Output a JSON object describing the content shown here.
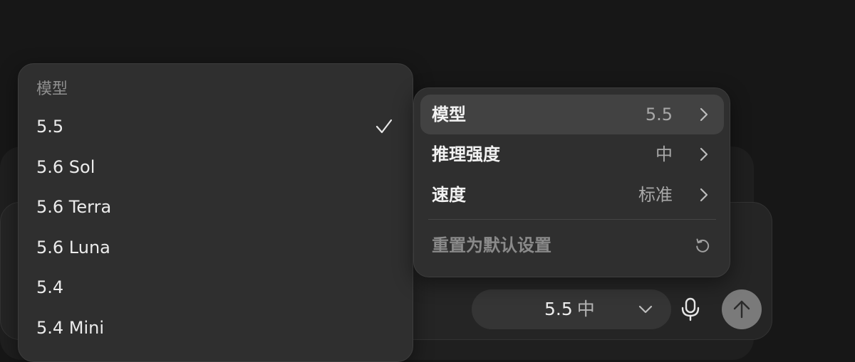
{
  "model_menu": {
    "header": "模型",
    "items": [
      {
        "label": "5.5",
        "selected": true
      },
      {
        "label": "5.6 Sol",
        "selected": false
      },
      {
        "label": "5.6 Terra",
        "selected": false
      },
      {
        "label": "5.6 Luna",
        "selected": false
      },
      {
        "label": "5.4",
        "selected": false
      },
      {
        "label": "5.4 Mini",
        "selected": false
      }
    ],
    "check_icon": "checkmark-icon"
  },
  "settings_panel": {
    "rows": [
      {
        "label": "模型",
        "value": "5.5",
        "icon": "chevron-right-icon",
        "active": true
      },
      {
        "label": "推理强度",
        "value": "中",
        "icon": "chevron-right-icon",
        "active": false
      },
      {
        "label": "速度",
        "value": "标准",
        "icon": "chevron-right-icon",
        "active": false
      }
    ],
    "reset": {
      "label": "重置为默认设置",
      "icon": "reset-icon"
    }
  },
  "composer": {
    "model_pill": {
      "model": "5.5",
      "effort": "中",
      "icon": "chevron-down-icon"
    },
    "mic_icon": "microphone-icon",
    "send_icon": "arrow-up-icon"
  },
  "colors": {
    "page_background": "#171717",
    "menu_background": "#2f2f2f",
    "active_row": "#424242",
    "send_button": "#7a7a7a",
    "muted_text": "#8f8f8f"
  }
}
